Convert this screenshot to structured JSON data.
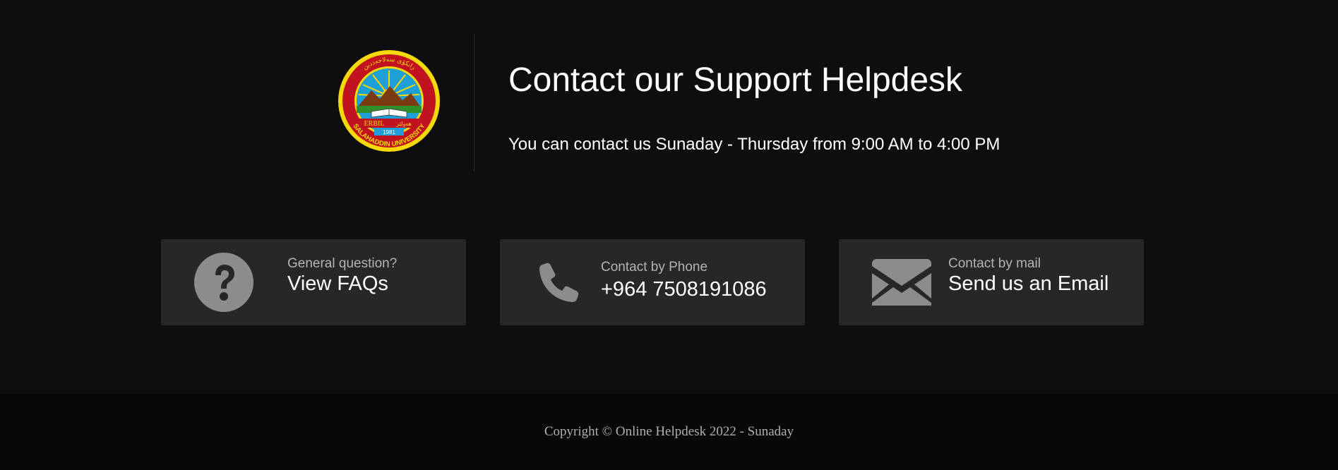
{
  "header": {
    "logo": {
      "name": "salahaddin-university-logo",
      "top_text": "زانكۆی سەلاحەددین",
      "city_en": "ERBIL",
      "city_ku": "هەولێر",
      "year": "1981",
      "bottom_text": "SALAHADDIN UNIVERSITY"
    },
    "title": "Contact our Support Helpdesk",
    "hours": "You can contact us Sunaday - Thursday from 9:00 AM to 4:00 PM"
  },
  "cards": [
    {
      "icon": "question-circle-icon",
      "label": "General question?",
      "value": "View FAQs"
    },
    {
      "icon": "phone-icon",
      "label": "Contact by Phone",
      "value": "+964 7508191086"
    },
    {
      "icon": "envelope-icon",
      "label": "Contact by mail",
      "value": "Send us an Email"
    }
  ],
  "footer": {
    "copyright": "Copyright © Online Helpdesk 2022 - Sunaday"
  },
  "colors": {
    "background": "#0e0e0e",
    "card_background": "#272727",
    "footer_background": "#080808",
    "icon_gray": "#8c8c8c",
    "muted_text": "#b3b3b3",
    "logo_gold": "#f5d90a",
    "logo_red": "#c1121f",
    "logo_sky": "#1e9fd8"
  }
}
